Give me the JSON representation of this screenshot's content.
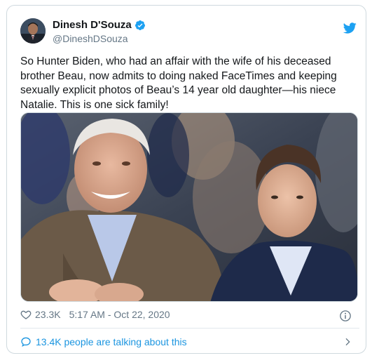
{
  "tweet": {
    "author_name": "Dinesh D'Souza",
    "author_handle": "@DineshDSouza",
    "text": "So Hunter Biden, who had an affair with the wife of his deceased brother Beau, now admits to doing naked FaceTimes and keeping sexually explicit photos of Beau’s 14 year old daughter—his niece Natalie. This is one sick family!",
    "likes": "23.3K",
    "timestamp": "5:17 AM - Oct 22, 2020",
    "talking": "13.4K people are talking about this"
  },
  "icons": {
    "verified": "verified-badge-icon",
    "twitter": "twitter-bird-icon",
    "heart": "heart-icon",
    "info": "info-icon",
    "comment": "comment-bubble-icon",
    "chevron": "chevron-right-icon"
  },
  "colors": {
    "brand_blue": "#1da1f2",
    "link_blue": "#1b95e0",
    "muted_gray": "#657786",
    "text": "#14171a",
    "border": "#cfd9de"
  }
}
